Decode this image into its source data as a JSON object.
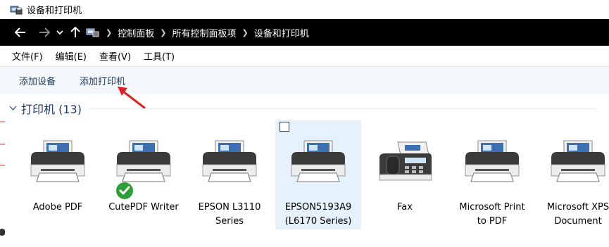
{
  "window": {
    "title": "设备和打印机"
  },
  "nav": {
    "breadcrumbs": [
      "控制面板",
      "所有控制面板项",
      "设备和打印机"
    ]
  },
  "menu": {
    "items": [
      "文件(F)",
      "编辑(E)",
      "查看(V)",
      "工具(T)"
    ]
  },
  "toolbar": {
    "add_device": "添加设备",
    "add_printer": "添加打印机"
  },
  "section": {
    "title": "打印机 (13)"
  },
  "devices": [
    {
      "label": "Adobe PDF",
      "icon": "printer-icon"
    },
    {
      "label": "CutePDF Writer",
      "icon": "printer-icon",
      "default": true
    },
    {
      "label": "EPSON L3110\nSeries",
      "icon": "printer-icon"
    },
    {
      "label": "EPSON5193A9\n(L6170 Series)",
      "icon": "printer-icon",
      "selected": true
    },
    {
      "label": "Fax",
      "icon": "fax-icon"
    },
    {
      "label": "Microsoft Print\nto PDF",
      "icon": "printer-icon"
    },
    {
      "label": "Microsoft XPS\nDocument\nWriter",
      "icon": "printer-icon"
    }
  ],
  "colors": {
    "selection": "#e5f1fb",
    "accent_text": "#1e3a78",
    "annotation_arrow": "#e02020",
    "default_badge": "#2aa036"
  }
}
